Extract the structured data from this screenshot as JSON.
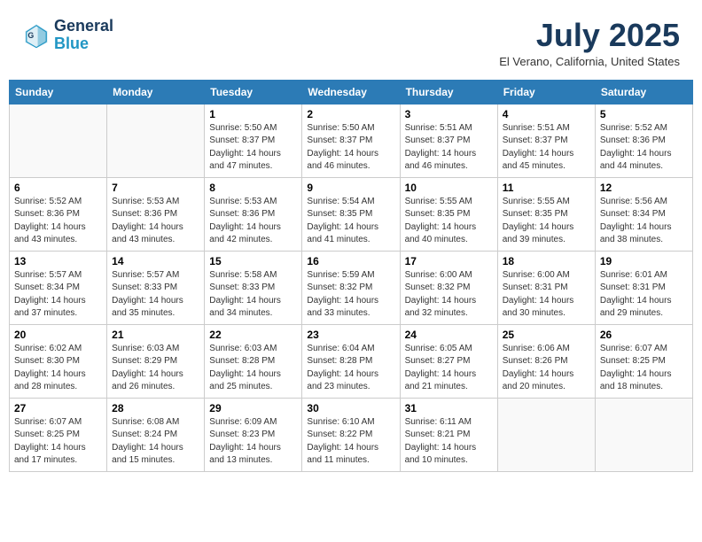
{
  "header": {
    "logo_line1": "General",
    "logo_line2": "Blue",
    "month": "July 2025",
    "location": "El Verano, California, United States"
  },
  "weekdays": [
    "Sunday",
    "Monday",
    "Tuesday",
    "Wednesday",
    "Thursday",
    "Friday",
    "Saturday"
  ],
  "weeks": [
    [
      {
        "day": "",
        "info": ""
      },
      {
        "day": "",
        "info": ""
      },
      {
        "day": "1",
        "info": "Sunrise: 5:50 AM\nSunset: 8:37 PM\nDaylight: 14 hours and 47 minutes."
      },
      {
        "day": "2",
        "info": "Sunrise: 5:50 AM\nSunset: 8:37 PM\nDaylight: 14 hours and 46 minutes."
      },
      {
        "day": "3",
        "info": "Sunrise: 5:51 AM\nSunset: 8:37 PM\nDaylight: 14 hours and 46 minutes."
      },
      {
        "day": "4",
        "info": "Sunrise: 5:51 AM\nSunset: 8:37 PM\nDaylight: 14 hours and 45 minutes."
      },
      {
        "day": "5",
        "info": "Sunrise: 5:52 AM\nSunset: 8:36 PM\nDaylight: 14 hours and 44 minutes."
      }
    ],
    [
      {
        "day": "6",
        "info": "Sunrise: 5:52 AM\nSunset: 8:36 PM\nDaylight: 14 hours and 43 minutes."
      },
      {
        "day": "7",
        "info": "Sunrise: 5:53 AM\nSunset: 8:36 PM\nDaylight: 14 hours and 43 minutes."
      },
      {
        "day": "8",
        "info": "Sunrise: 5:53 AM\nSunset: 8:36 PM\nDaylight: 14 hours and 42 minutes."
      },
      {
        "day": "9",
        "info": "Sunrise: 5:54 AM\nSunset: 8:35 PM\nDaylight: 14 hours and 41 minutes."
      },
      {
        "day": "10",
        "info": "Sunrise: 5:55 AM\nSunset: 8:35 PM\nDaylight: 14 hours and 40 minutes."
      },
      {
        "day": "11",
        "info": "Sunrise: 5:55 AM\nSunset: 8:35 PM\nDaylight: 14 hours and 39 minutes."
      },
      {
        "day": "12",
        "info": "Sunrise: 5:56 AM\nSunset: 8:34 PM\nDaylight: 14 hours and 38 minutes."
      }
    ],
    [
      {
        "day": "13",
        "info": "Sunrise: 5:57 AM\nSunset: 8:34 PM\nDaylight: 14 hours and 37 minutes."
      },
      {
        "day": "14",
        "info": "Sunrise: 5:57 AM\nSunset: 8:33 PM\nDaylight: 14 hours and 35 minutes."
      },
      {
        "day": "15",
        "info": "Sunrise: 5:58 AM\nSunset: 8:33 PM\nDaylight: 14 hours and 34 minutes."
      },
      {
        "day": "16",
        "info": "Sunrise: 5:59 AM\nSunset: 8:32 PM\nDaylight: 14 hours and 33 minutes."
      },
      {
        "day": "17",
        "info": "Sunrise: 6:00 AM\nSunset: 8:32 PM\nDaylight: 14 hours and 32 minutes."
      },
      {
        "day": "18",
        "info": "Sunrise: 6:00 AM\nSunset: 8:31 PM\nDaylight: 14 hours and 30 minutes."
      },
      {
        "day": "19",
        "info": "Sunrise: 6:01 AM\nSunset: 8:31 PM\nDaylight: 14 hours and 29 minutes."
      }
    ],
    [
      {
        "day": "20",
        "info": "Sunrise: 6:02 AM\nSunset: 8:30 PM\nDaylight: 14 hours and 28 minutes."
      },
      {
        "day": "21",
        "info": "Sunrise: 6:03 AM\nSunset: 8:29 PM\nDaylight: 14 hours and 26 minutes."
      },
      {
        "day": "22",
        "info": "Sunrise: 6:03 AM\nSunset: 8:28 PM\nDaylight: 14 hours and 25 minutes."
      },
      {
        "day": "23",
        "info": "Sunrise: 6:04 AM\nSunset: 8:28 PM\nDaylight: 14 hours and 23 minutes."
      },
      {
        "day": "24",
        "info": "Sunrise: 6:05 AM\nSunset: 8:27 PM\nDaylight: 14 hours and 21 minutes."
      },
      {
        "day": "25",
        "info": "Sunrise: 6:06 AM\nSunset: 8:26 PM\nDaylight: 14 hours and 20 minutes."
      },
      {
        "day": "26",
        "info": "Sunrise: 6:07 AM\nSunset: 8:25 PM\nDaylight: 14 hours and 18 minutes."
      }
    ],
    [
      {
        "day": "27",
        "info": "Sunrise: 6:07 AM\nSunset: 8:25 PM\nDaylight: 14 hours and 17 minutes."
      },
      {
        "day": "28",
        "info": "Sunrise: 6:08 AM\nSunset: 8:24 PM\nDaylight: 14 hours and 15 minutes."
      },
      {
        "day": "29",
        "info": "Sunrise: 6:09 AM\nSunset: 8:23 PM\nDaylight: 14 hours and 13 minutes."
      },
      {
        "day": "30",
        "info": "Sunrise: 6:10 AM\nSunset: 8:22 PM\nDaylight: 14 hours and 11 minutes."
      },
      {
        "day": "31",
        "info": "Sunrise: 6:11 AM\nSunset: 8:21 PM\nDaylight: 14 hours and 10 minutes."
      },
      {
        "day": "",
        "info": ""
      },
      {
        "day": "",
        "info": ""
      }
    ]
  ]
}
